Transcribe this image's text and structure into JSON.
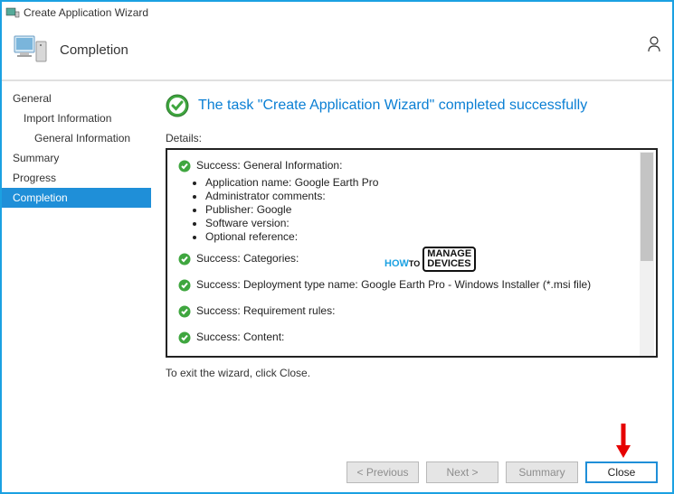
{
  "titlebar": {
    "title": "Create Application Wizard"
  },
  "header": {
    "title": "Completion"
  },
  "sidebar": {
    "items": [
      {
        "label": "General"
      },
      {
        "label": "Import Information"
      },
      {
        "label": "General Information"
      },
      {
        "label": "Summary"
      },
      {
        "label": "Progress"
      },
      {
        "label": "Completion"
      }
    ]
  },
  "banner": {
    "text": "The task \"Create Application Wizard\" completed successfully"
  },
  "details": {
    "label": "Details:",
    "section1": {
      "heading": "Success: General Information:",
      "items": [
        "Application name: Google Earth Pro",
        "Administrator comments:",
        "Publisher: Google",
        "Software version:",
        "Optional reference:"
      ]
    },
    "section2": {
      "heading": "Success: Categories:"
    },
    "section3": {
      "heading": "Success: Deployment type name: Google Earth Pro - Windows Installer (*.msi file)"
    },
    "section4": {
      "heading": "Success: Requirement rules:"
    },
    "section5": {
      "heading": "Success: Content:"
    }
  },
  "exit_hint": "To exit the wizard, click Close.",
  "footer": {
    "previous": "< Previous",
    "next": "Next >",
    "summary": "Summary",
    "close": "Close"
  },
  "watermark": {
    "how": "HOW",
    "to": "TO",
    "manage": "MANAGE",
    "devices": "DEVICES"
  }
}
